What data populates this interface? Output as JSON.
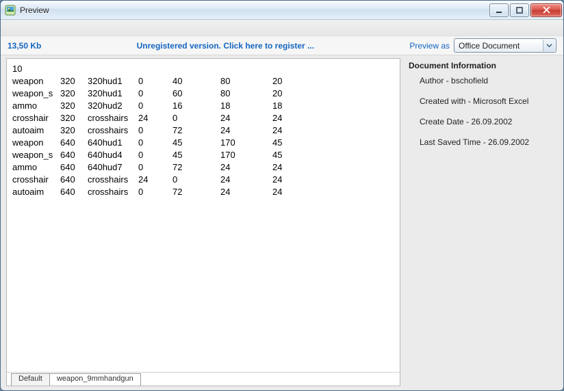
{
  "window": {
    "title": "Preview"
  },
  "subheader": {
    "filesize": "13,50 Kb",
    "register_link": "Unregistered version. Click here to register ...",
    "preview_as_label": "Preview as",
    "preview_as_value": "Office Document"
  },
  "doc": {
    "first_line": "10",
    "rows": [
      {
        "c1": "weapon",
        "c2": "320",
        "c3": "320hud1",
        "c4": "0",
        "c5": "40",
        "c6": "80",
        "c7": "20"
      },
      {
        "c1": "weapon_s",
        "c2": "320",
        "c3": "320hud1",
        "c4": "0",
        "c5": "60",
        "c6": "80",
        "c7": "20"
      },
      {
        "c1": "ammo",
        "c2": "320",
        "c3": "320hud2",
        "c4": "0",
        "c5": "16",
        "c6": "18",
        "c7": "18"
      },
      {
        "c1": "crosshair",
        "c2": "320",
        "c3": "crosshairs",
        "c4": "24",
        "c5": "0",
        "c6": "24",
        "c7": "24"
      },
      {
        "c1": "autoaim",
        "c2": "320",
        "c3": "crosshairs",
        "c4": "0",
        "c5": "72",
        "c6": "24",
        "c7": "24"
      },
      {
        "c1": "weapon",
        "c2": "640",
        "c3": "640hud1",
        "c4": "0",
        "c5": "45",
        "c6": "170",
        "c7": "45"
      },
      {
        "c1": "weapon_s",
        "c2": "640",
        "c3": "640hud4",
        "c4": "0",
        "c5": "45",
        "c6": "170",
        "c7": "45"
      },
      {
        "c1": "ammo",
        "c2": "640",
        "c3": "640hud7",
        "c4": "0",
        "c5": "72",
        "c6": "24",
        "c7": "24"
      },
      {
        "c1": "crosshair",
        "c2": "640",
        "c3": "crosshairs",
        "c4": "24",
        "c5": "0",
        "c6": "24",
        "c7": "24"
      },
      {
        "c1": "autoaim",
        "c2": "640",
        "c3": "crosshairs",
        "c4": "0",
        "c5": "72",
        "c6": "24",
        "c7": "24"
      }
    ],
    "sheet_tabs": [
      {
        "label": "Default",
        "active": false
      },
      {
        "label": "weapon_9mmhandgun",
        "active": true
      }
    ]
  },
  "info": {
    "heading": "Document Information",
    "rows": [
      "Author - bschofield",
      "Created with - Microsoft Excel",
      "Create Date - 26.09.2002",
      "Last Saved Time - 26.09.2002"
    ]
  }
}
